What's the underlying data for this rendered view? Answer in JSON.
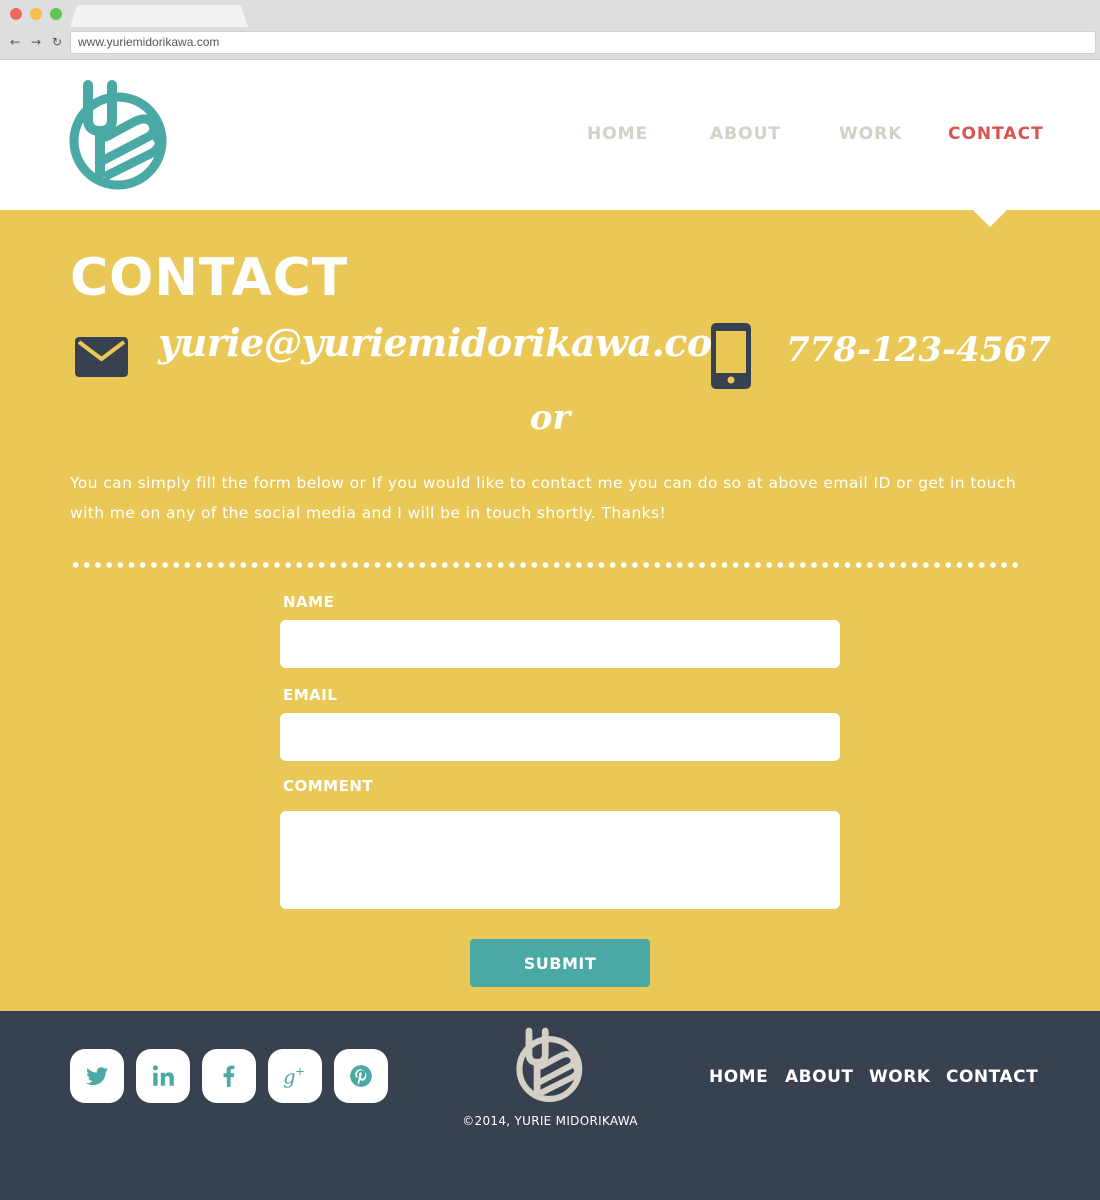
{
  "browser": {
    "url": "www.yuriemidorikawa.com",
    "traffic_lights": [
      "#ec6b5e",
      "#f4bf4f",
      "#61c554"
    ],
    "back_icon": "arrow-left-icon",
    "forward_icon": "arrow-right-icon",
    "reload_icon": "reload-icon"
  },
  "brand": {
    "logo_icon": "ym-monogram-logo",
    "logo_color": "#4aa9a4"
  },
  "nav": {
    "items": [
      {
        "label": "HOME",
        "active": false
      },
      {
        "label": "ABOUT",
        "active": false
      },
      {
        "label": "WORK",
        "active": false
      },
      {
        "label": "CONTACT",
        "active": true
      }
    ],
    "inactive_color": "#d4d0c6",
    "active_color": "#d9534f"
  },
  "contact": {
    "title": "CONTACT",
    "email": "yurie@yuriemidorikawa.com",
    "email_icon": "envelope-icon",
    "phone": "778-123-4567",
    "phone_icon": "mobile-phone-icon",
    "or": "or",
    "intro": "You can simply fill the form below or If you would like to contact me you can do so at above email ID or get in touch with me on any of the social media and I will be in touch shortly. Thanks!",
    "background_color": "#e9c858"
  },
  "form": {
    "name_label": "NAME",
    "name_value": "",
    "email_label": "EMAIL",
    "email_value": "",
    "comment_label": "COMMENT",
    "comment_value": "",
    "submit_label": "SUBMIT",
    "submit_color": "#4aa9a4"
  },
  "footer": {
    "background_color": "#384150",
    "social": [
      {
        "name": "twitter-icon"
      },
      {
        "name": "linkedin-icon"
      },
      {
        "name": "facebook-icon"
      },
      {
        "name": "google-plus-icon"
      },
      {
        "name": "pinterest-icon"
      }
    ],
    "copyright": "©2014, YURIE MIDORIKAWA",
    "nav": [
      "HOME",
      "ABOUT",
      "WORK",
      "CONTACT"
    ]
  }
}
